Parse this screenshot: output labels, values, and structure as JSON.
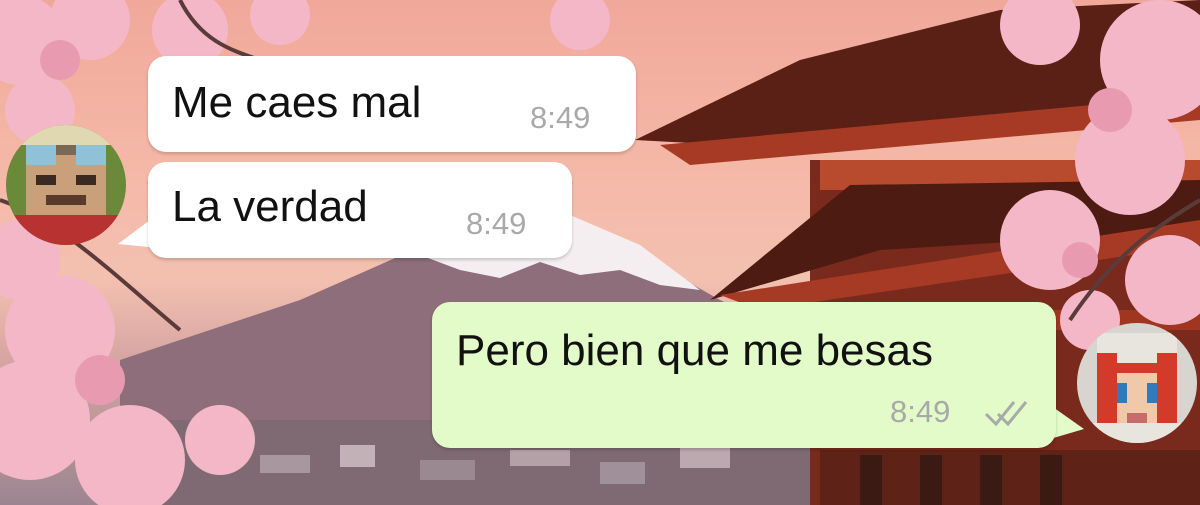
{
  "chat": {
    "messages": [
      {
        "direction": "incoming",
        "text": "Me caes mal",
        "time": "8:49"
      },
      {
        "direction": "incoming",
        "text": "La verdad",
        "time": "8:49"
      },
      {
        "direction": "outgoing",
        "text": "Pero bien que me besas",
        "time": "8:49",
        "status_icon": "double-check-icon"
      }
    ]
  },
  "avatars": {
    "left": {
      "icon": "pixel-avatar-goggles"
    },
    "right": {
      "icon": "pixel-avatar-red-hair"
    }
  },
  "colors": {
    "incoming_bubble": "#ffffff",
    "outgoing_bubble": "#e2fbc8",
    "timestamp": "#a9a9a9",
    "text": "#111111",
    "sky": "#f5b9a8"
  }
}
